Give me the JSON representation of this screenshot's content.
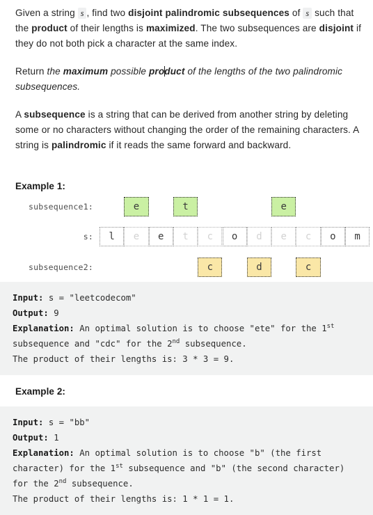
{
  "intro": {
    "p1_a": "Given a string ",
    "p1_code1": "s",
    "p1_b": ", find two ",
    "p1_bold1": "disjoint palindromic subsequences",
    "p1_c": " of ",
    "p1_code2": "s",
    "p1_d": " such that the ",
    "p1_bold2": "product",
    "p1_e": " of their lengths is ",
    "p1_bold3": "maximized",
    "p1_f": ". The two subsequences are ",
    "p1_bold4": "disjoint",
    "p1_g": " if they do not both pick a character at the same index.",
    "p2_a": "Return ",
    "p2_i1": "the ",
    "p2_bi1": "maximum",
    "p2_i2": " possible ",
    "p2_bi2a": "pro",
    "p2_bi2b": "duct",
    "p2_i3": " of the lengths of the two palindromic subsequences.",
    "p3_a": "A ",
    "p3_bold1": "subsequence",
    "p3_b": " is a string that can be derived from another string by deleting some or no characters without changing the order of the remaining characters. A string is ",
    "p3_bold2": "palindromic",
    "p3_c": " if it reads the same forward and backward."
  },
  "example1": {
    "title": "Example 1:",
    "diagram": {
      "label_sub1": "subsequence1:",
      "label_s": "s:",
      "label_sub2": "subsequence2:",
      "string": "leetcodecom",
      "cells": [
        {
          "ch": "l",
          "strong": true
        },
        {
          "ch": "e",
          "strong": false
        },
        {
          "ch": "e",
          "strong": true
        },
        {
          "ch": "t",
          "strong": false
        },
        {
          "ch": "c",
          "strong": false
        },
        {
          "ch": "o",
          "strong": true
        },
        {
          "ch": "d",
          "strong": false
        },
        {
          "ch": "e",
          "strong": false
        },
        {
          "ch": "c",
          "strong": false
        },
        {
          "ch": "o",
          "strong": true
        },
        {
          "ch": "m",
          "strong": true
        }
      ],
      "subsequence1": [
        {
          "index": 1,
          "ch": "e"
        },
        {
          "index": 3,
          "ch": "t"
        },
        {
          "index": 7,
          "ch": "e"
        }
      ],
      "subsequence2": [
        {
          "index": 4,
          "ch": "c"
        },
        {
          "index": 6,
          "ch": "d"
        },
        {
          "index": 8,
          "ch": "c"
        }
      ],
      "colors": {
        "green": "#caf0a3",
        "yellow": "#fae7a7"
      }
    },
    "code": {
      "input_key": "Input:",
      "input_val": " s = \"leetcodecom\"",
      "output_key": "Output:",
      "output_val": " 9",
      "expl_key": "Explanation:",
      "expl_1": " An optimal solution is to choose \"ete\" for the 1",
      "expl_sup1": "st",
      "expl_2": " subsequence and \"cdc\" for the 2",
      "expl_sup2": "nd",
      "expl_3": " subsequence.",
      "expl_4": "The product of their lengths is: 3 * 3 = 9."
    }
  },
  "example2": {
    "title": "Example 2:",
    "code": {
      "input_key": "Input:",
      "input_val": " s = \"bb\"",
      "output_key": "Output:",
      "output_val": " 1",
      "expl_key": "Explanation:",
      "expl_1": " An optimal solution is to choose \"b\" (the first character) for the 1",
      "expl_sup1": "st",
      "expl_2": " subsequence and \"b\" (the second character) for the 2",
      "expl_sup2": "nd",
      "expl_3": " subsequence.",
      "expl_4": "The product of their lengths is: 1 * 1 = 1."
    }
  }
}
